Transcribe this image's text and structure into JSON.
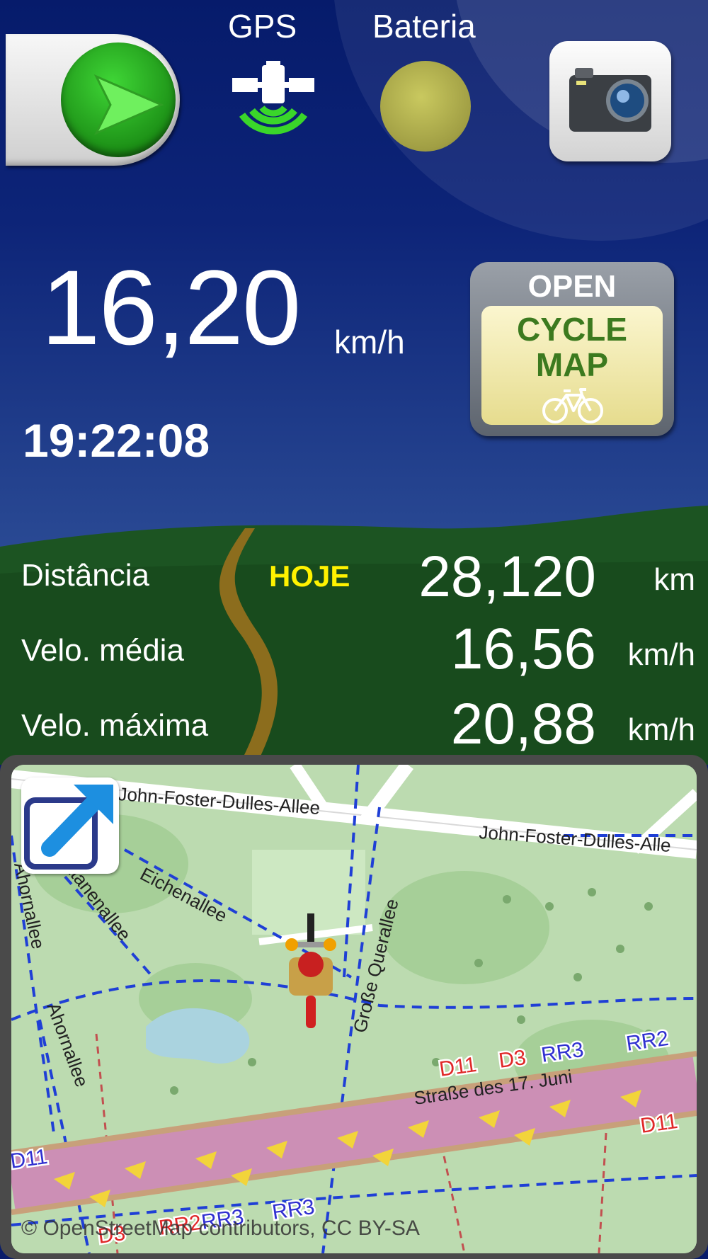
{
  "top_bar": {
    "start_button": {
      "icon": "play-icon",
      "color": "#2ab51f"
    },
    "gps": {
      "label": "GPS",
      "icon": "satellite-icon",
      "signal_color": "#3ad62a"
    },
    "battery": {
      "label": "Bateria",
      "icon": "battery-indicator-icon",
      "color": "#c9c23e"
    },
    "camera_button": {
      "icon": "camera-icon"
    }
  },
  "speed": {
    "value": "16,20",
    "unit": "km/h"
  },
  "clock": "19:22:08",
  "map_source_button": {
    "line1": "OPEN",
    "line2": "CYCLE",
    "line3": "MAP",
    "icon": "bicycle-icon"
  },
  "stats": {
    "period": "HOJE",
    "rows": [
      {
        "label": "Distância",
        "value": "28,120",
        "unit": "km"
      },
      {
        "label": "Velo. média",
        "value": "16,56",
        "unit": "km/h"
      },
      {
        "label": "Velo. máxima",
        "value": "20,88",
        "unit": "km/h"
      }
    ]
  },
  "map": {
    "expand_icon": "expand-map-icon",
    "position_marker": "cyclist-position-icon",
    "streets": [
      "John-Foster-Dulles-Allee",
      "John-Foster-Dulles-Alle",
      "Eichenallee",
      "latanenallee",
      "Ahornallee",
      "Ahornallee",
      "Große Querallee",
      "Straße des 17. Juni"
    ],
    "route_labels": [
      "D11",
      "D3",
      "RR3",
      "RR2",
      "D11",
      "D3",
      "RR2",
      "RR3",
      "RR3",
      "D11"
    ],
    "attribution": "© OpenStreetMap contributors, CC BY-SA"
  }
}
